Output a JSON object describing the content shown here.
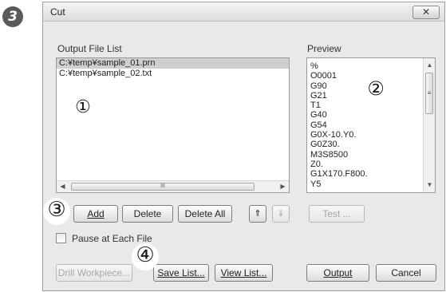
{
  "step_badge": "3",
  "dialog": {
    "title": "Cut",
    "close_glyph": "✕"
  },
  "output_list": {
    "label": "Output File List",
    "items": [
      "C:¥temp¥sample_01.prn",
      "C:¥temp¥sample_02.txt"
    ],
    "selected_index": 0,
    "scroll_thumb_glyph": "III"
  },
  "preview": {
    "label": "Preview",
    "lines": [
      "%",
      "O0001",
      "G90",
      "G21",
      "T1",
      "G40",
      "G54",
      "G0X-10.Y0.",
      "G0Z30.",
      "M3S8500",
      "Z0.",
      "G1X170.F800.",
      "Y5"
    ],
    "scroll_thumb_glyph": "≡"
  },
  "buttons": {
    "add": "Add",
    "delete": "Delete",
    "delete_all": "Delete All",
    "move_up_glyph": "⇑",
    "move_down_glyph": "⇓",
    "test": "Test ...",
    "drill_workpiece": "Drill Workpiece...",
    "save_list": "Save List...",
    "view_list": "View List...",
    "output": "Output",
    "cancel": "Cancel"
  },
  "pause_checkbox": {
    "label": "Pause at Each File",
    "checked": false
  },
  "callouts": [
    "①",
    "②",
    "③",
    "④"
  ]
}
